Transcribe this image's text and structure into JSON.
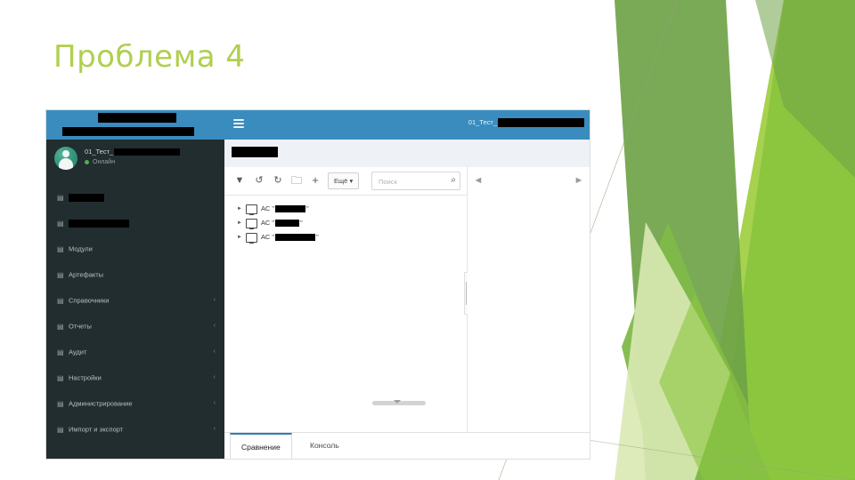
{
  "slide": {
    "title": "Проблема 4",
    "title_color": "#b0cf4e",
    "background_color": "#ffffff",
    "theme_greens": [
      "#6fa348",
      "#8cc63f",
      "#a6d24f",
      "#d9e9b4",
      "#e6f0d2"
    ]
  },
  "app": {
    "accent_blue": "#3a8cbe",
    "sidebar_bg": "#222d30",
    "sidebar": {
      "header": {
        "logo_redacted": true,
        "title_redacted": true
      },
      "user": {
        "name": "01_Тест_",
        "name_redacted": true,
        "status": "Онлайн",
        "status_dot_color": "#4caf50",
        "avatar_icon": "user-avatar"
      },
      "items": [
        {
          "label": "",
          "redacted": true,
          "redact_width": 40,
          "icon": "anchor-icon",
          "caret": false
        },
        {
          "label": "",
          "redacted": true,
          "redact_width": 68,
          "icon": "book-icon",
          "caret": false
        },
        {
          "label": "Модули",
          "redacted": false,
          "icon": "modules-icon",
          "caret": false
        },
        {
          "label": "Артефакты",
          "redacted": false,
          "icon": "artifact-icon",
          "caret": false
        },
        {
          "label": "Справочники",
          "redacted": false,
          "icon": "catalog-icon",
          "caret": true
        },
        {
          "label": "Отчеты",
          "redacted": false,
          "icon": "report-icon",
          "caret": true
        },
        {
          "label": "Аудит",
          "redacted": false,
          "icon": "audit-icon",
          "caret": true
        },
        {
          "label": "Настройки",
          "redacted": false,
          "icon": "gear-icon",
          "caret": true
        },
        {
          "label": "Администрирование",
          "redacted": false,
          "icon": "admin-icon",
          "caret": true
        },
        {
          "label": "Импорт и экспорт",
          "redacted": false,
          "icon": "import-export-icon",
          "caret": true
        }
      ],
      "caret_glyph": "‹"
    },
    "topbar": {
      "menu_icon": "hamburger-icon",
      "account_label": "01_Тест_",
      "account_redacted": true
    },
    "breadcrumb": {
      "redacted": true
    },
    "toolbar": {
      "icons": [
        {
          "name": "filter-icon",
          "glyph": "▼"
        },
        {
          "name": "refresh-icon",
          "glyph": "↺"
        },
        {
          "name": "undo-icon",
          "glyph": "↻"
        },
        {
          "name": "folder-icon",
          "glyph": "🗀"
        },
        {
          "name": "add-icon",
          "glyph": "+"
        }
      ],
      "more_label": "Ещё",
      "more_caret": "▾",
      "search_placeholder": "Поиск",
      "search_value": "",
      "search_icon": "search-icon"
    },
    "tree": {
      "expand_glyph": "►",
      "node_icon": "monitor-icon",
      "nodes": [
        {
          "prefix": "АС \"",
          "suffix": "\"",
          "redact_width": 34
        },
        {
          "prefix": "АС \"",
          "suffix": "\"",
          "redact_width": 27
        },
        {
          "prefix": "АС \"",
          "suffix": "\"",
          "redact_width": 45
        }
      ]
    },
    "detail_pane": {
      "prev_icon": "chevron-left-icon",
      "next_icon": "chevron-right-icon",
      "content": ""
    },
    "tabs": [
      {
        "label": "Сравнение",
        "active": true
      },
      {
        "label": "Консоль",
        "active": false
      }
    ]
  }
}
